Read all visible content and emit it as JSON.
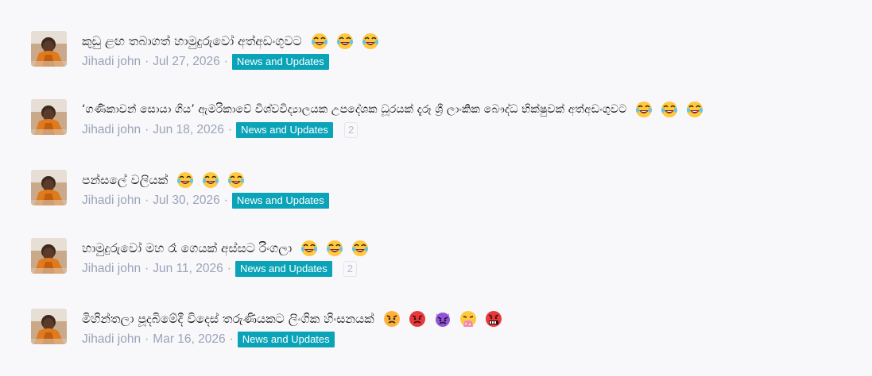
{
  "threads": [
    {
      "title": "කුඩු ළඟ තබාගත් හාමුදුරුවෝ අත්අඩංගුවට",
      "author": "Jihadi john",
      "date": "Jul 27, 2026",
      "tag": "News and Updates",
      "reply_count": "",
      "emojis": [
        "rofl-emoji",
        "rofl-emoji",
        "rofl-emoji"
      ]
    },
    {
      "title": "‘ගණිකාවන් සොයා ගිය’ ඇමරිකාවේ විශ්වවිද්‍යාලයක උපදේශක ධූරයක් දැරූ ශ්‍රී ලාංකික බෞද්ධ භික්ෂුවක් අත්අඩංගුවට",
      "author": "Jihadi john",
      "date": "Jun 18, 2026",
      "tag": "News and Updates",
      "reply_count": "2",
      "emojis": [
        "rofl-emoji",
        "rofl-emoji",
        "rofl-emoji"
      ]
    },
    {
      "title": "පන්සලේ වලියක්",
      "author": "Jihadi john",
      "date": "Jul 30, 2026",
      "tag": "News and Updates",
      "reply_count": "",
      "emojis": [
        "rofl-emoji",
        "rofl-emoji",
        "rofl-emoji"
      ]
    },
    {
      "title": "හාමුදුරුවෝ මහ රෑ ගෙයක් අස්සට රිංගලා",
      "author": "Jihadi john",
      "date": "Jun 11, 2026",
      "tag": "News and Updates",
      "reply_count": "2",
      "emojis": [
        "rofl-emoji",
        "rofl-emoji",
        "rofl-emoji"
      ]
    },
    {
      "title": "මිහින්තලා පූදබිමේදී විදෙස් තරුණියකට ලිංගික හිංසනයක්",
      "author": "Jihadi john",
      "date": "Mar 16, 2026",
      "tag": "News and Updates",
      "reply_count": "",
      "emojis": [
        "angry-emoji",
        "pouting-emoji",
        "devil-emoji",
        "vomit-emoji",
        "cursing-emoji"
      ]
    }
  ],
  "colors": {
    "tag_bg": "#0aa3b8",
    "meta_text": "#9aa3b8",
    "background": "#f8f8fb"
  }
}
